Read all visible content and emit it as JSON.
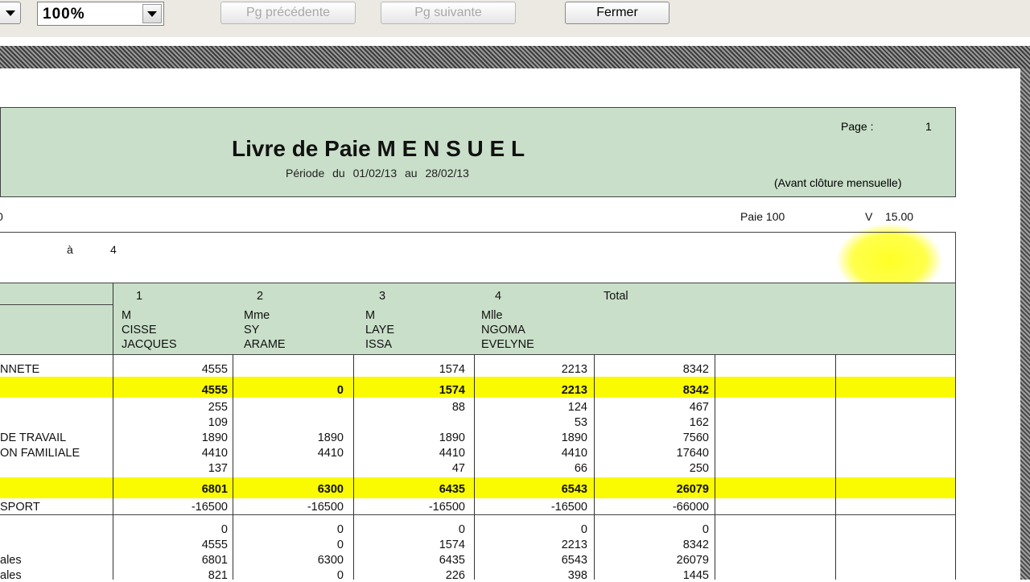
{
  "toolbar": {
    "zoom": "100%",
    "prev_label": "Pg précédente",
    "next_label": "Pg suivante",
    "close_label": "Fermer"
  },
  "report": {
    "title": "Livre de Paie M E N S U E L",
    "period": "Période du 01/02/13 au 28/02/13",
    "page_label": "Page :",
    "page_number": "1",
    "status": "(Avant clôture mensuelle)",
    "left_char": "0",
    "paie": "Paie 100",
    "version_label": "V",
    "version": "15.00",
    "range_a": "à",
    "range_to": "4",
    "highlight_color": "#fafa00",
    "header_color": "#c9dfc9"
  },
  "columns": {
    "numbers": [
      "1",
      "2",
      "3",
      "4"
    ],
    "total_label": "Total",
    "employees": [
      {
        "civ": "M",
        "last": "CISSE",
        "first": "JACQUES"
      },
      {
        "civ": "Mme",
        "last": "SY",
        "first": "ARAME"
      },
      {
        "civ": "M",
        "last": "LAYE",
        "first": "ISSA"
      },
      {
        "civ": "Mlle",
        "last": "NGOMA",
        "first": "EVELYNE"
      }
    ]
  },
  "rows": [
    {
      "label": "NNETE",
      "values": [
        "4555",
        "",
        "1574",
        "2213",
        "8342"
      ]
    },
    {
      "label": "",
      "values": [
        "4555",
        "0",
        "1574",
        "2213",
        "8342"
      ]
    },
    {
      "label": "",
      "values": [
        "255",
        "",
        "88",
        "124",
        "467"
      ]
    },
    {
      "label": "",
      "values": [
        "109",
        "",
        "",
        "53",
        "162"
      ]
    },
    {
      "label": "DE TRAVAIL",
      "values": [
        "1890",
        "1890",
        "1890",
        "1890",
        "7560"
      ]
    },
    {
      "label": "ON FAMILIALE",
      "values": [
        "4410",
        "4410",
        "4410",
        "4410",
        "17640"
      ]
    },
    {
      "label": "",
      "values": [
        "137",
        "",
        "47",
        "66",
        "250"
      ]
    },
    {
      "label": "",
      "values": [
        "6801",
        "6300",
        "6435",
        "6543",
        "26079"
      ]
    },
    {
      "label": "SPORT",
      "values": [
        "-16500",
        "-16500",
        "-16500",
        "-16500",
        "-66000"
      ]
    },
    {
      "label": "",
      "values": [
        "0",
        "0",
        "0",
        "0",
        "0"
      ]
    },
    {
      "label": "",
      "values": [
        "4555",
        "0",
        "1574",
        "2213",
        "8342"
      ]
    },
    {
      "label": "ales",
      "values": [
        "6801",
        "6300",
        "6435",
        "6543",
        "26079"
      ]
    },
    {
      "label": "ales",
      "values": [
        "821",
        "0",
        "226",
        "398",
        "1445"
      ]
    }
  ]
}
